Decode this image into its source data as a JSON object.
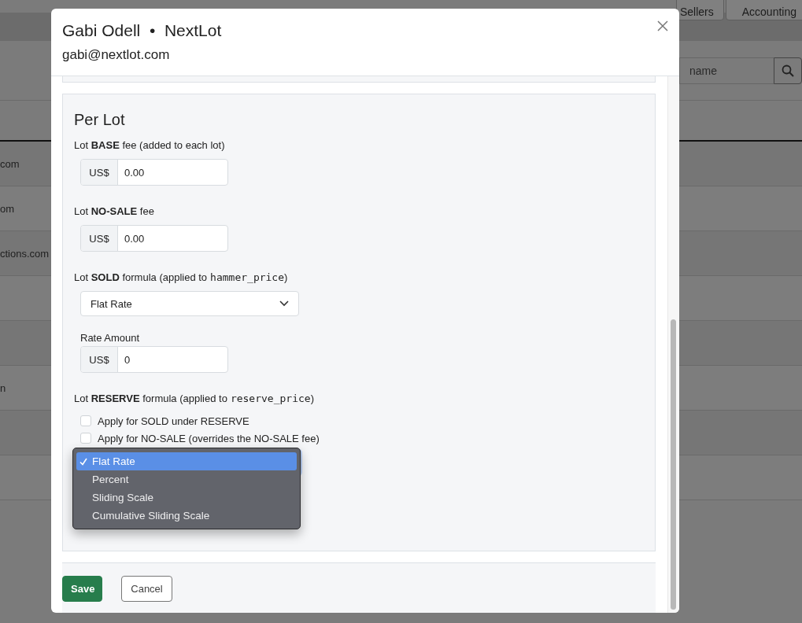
{
  "background": {
    "nav_buttons": [
      {
        "label": "Sellers"
      },
      {
        "label": "Accounting"
      }
    ],
    "search": {
      "placeholder": "name"
    },
    "table_rows": [
      {
        "text": "com"
      },
      {
        "text": "om"
      },
      {
        "text": "ctions.com"
      },
      {},
      {},
      {
        "text": "n"
      },
      {},
      {}
    ]
  },
  "modal": {
    "title": "Gabi Odell  •  NextLot",
    "subtitle": "gabi@nextlot.com",
    "section": {
      "heading": "Per Lot",
      "fields": [
        {
          "kind": "money",
          "label": "Lot **BASE** fee (added to each lot)",
          "prefix": "US$",
          "value": "0.00"
        },
        {
          "kind": "money",
          "label": "Lot **NO-SALE** fee",
          "prefix": "US$",
          "value": "0.00"
        },
        {
          "kind": "select",
          "label": "Lot **SOLD** formula (applied to",
          "code": "hammer_price",
          "suffix": ")",
          "value": "Flat Rate",
          "sub_label": "Rate Amount",
          "prefix": "US$",
          "sub_value": "0"
        },
        {
          "kind": "reserve",
          "label": "Lot **RESERVE** formula (applied to",
          "code": "reserve_price",
          "suffix": ")",
          "checkboxes": [
            {
              "label": "Apply for SOLD under RESERVE",
              "checked": false
            },
            {
              "label": "Apply for NO-SALE (overrides the NO-SALE fee)",
              "checked": false
            }
          ],
          "menu": [
            {
              "label": "Flat Rate",
              "selected": true
            },
            {
              "label": "Percent",
              "selected": false
            },
            {
              "label": "Sliding Scale",
              "selected": false
            },
            {
              "label": "Cumulative Sliding Scale",
              "selected": false
            }
          ]
        }
      ]
    },
    "buttons": [
      {
        "label": "Save",
        "kind": "primary"
      },
      {
        "label": "Cancel",
        "kind": "secondary"
      }
    ]
  }
}
